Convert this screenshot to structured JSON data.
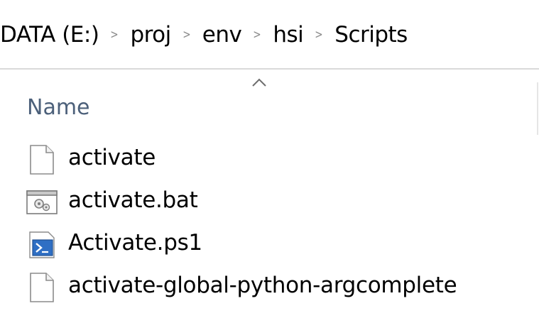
{
  "breadcrumb": {
    "items": [
      {
        "label": "DATA (E:)"
      },
      {
        "label": "proj"
      },
      {
        "label": "env"
      },
      {
        "label": "hsi"
      },
      {
        "label": "Scripts"
      }
    ],
    "separator": "›"
  },
  "columns": {
    "name_label": "Name",
    "sort": "ascending"
  },
  "files": [
    {
      "name": "activate",
      "icon": "generic-file-icon"
    },
    {
      "name": "activate.bat",
      "icon": "batch-file-icon"
    },
    {
      "name": "Activate.ps1",
      "icon": "powershell-script-icon"
    },
    {
      "name": "activate-global-python-argcomplete",
      "icon": "generic-file-icon"
    }
  ],
  "colors": {
    "header_text": "#4c607a",
    "separator": "#8a8a8a",
    "powershell_blue": "#2f6fc4"
  }
}
